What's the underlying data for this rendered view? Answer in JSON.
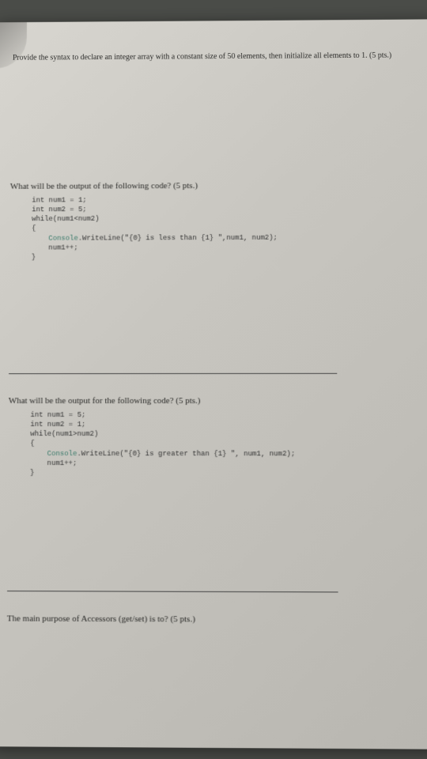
{
  "q1": {
    "text": "Provide the syntax to declare an integer array with a constant size of 50 elements, then initialize all elements to 1. (5 pts.)"
  },
  "q2": {
    "text": "What will be the output of the following code? (5 pts.)",
    "code_l1": "int num1 = 1;",
    "code_l2": "int num2 = 5;",
    "code_l3": "while(num1<num2)",
    "code_l4": "{",
    "code_l5a": "    Console",
    "code_l5b": ".WriteLine(\"{0} is less than {1} \",num1, num2);",
    "code_l6": "    num1++;",
    "code_l7": "}"
  },
  "q3": {
    "text": "What will be the output for the following code? (5 pts.)",
    "code_l1": "int num1 = 5;",
    "code_l2": "int num2 = 1;",
    "code_l3": "while(num1>num2)",
    "code_l4": "{",
    "code_l5a": "    Console",
    "code_l5b": ".WriteLine(\"{0} is greater than {1} \", num1, num2);",
    "code_l6": "    num1++;",
    "code_l7": "}"
  },
  "q4": {
    "text": "The main purpose of Accessors (get/set) is to? (5 pts.)"
  }
}
